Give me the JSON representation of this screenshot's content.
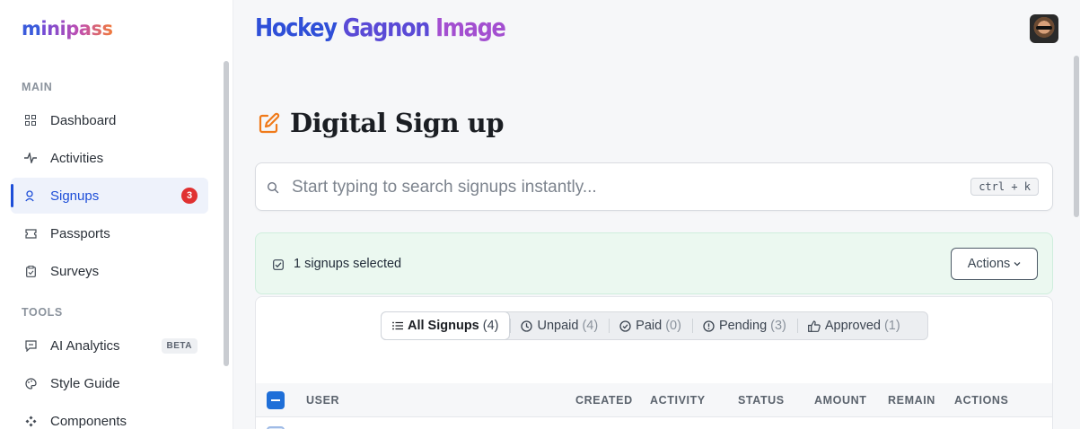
{
  "app": {
    "logo_prefix": "m",
    "logo_rest": "inipass"
  },
  "sidebar": {
    "sections": [
      {
        "label": "MAIN",
        "items": [
          {
            "label": "Dashboard",
            "icon": "dashboard-grid-icon"
          },
          {
            "label": "Activities",
            "icon": "activity-pulse-icon"
          },
          {
            "label": "Signups",
            "icon": "user-signup-icon",
            "active": true,
            "badge": "3"
          },
          {
            "label": "Passports",
            "icon": "ticket-icon"
          },
          {
            "label": "Surveys",
            "icon": "clipboard-icon"
          }
        ]
      },
      {
        "label": "TOOLS",
        "items": [
          {
            "label": "AI Analytics",
            "icon": "chat-analytics-icon",
            "tag": "BETA"
          },
          {
            "label": "Style Guide",
            "icon": "palette-icon"
          },
          {
            "label": "Components",
            "icon": "components-icon"
          }
        ]
      }
    ]
  },
  "header": {
    "org_title_words": [
      "Hockey",
      "Gagnon",
      "Image"
    ]
  },
  "page": {
    "title": "Digital Sign up",
    "icon": "edit-pencil-icon"
  },
  "search": {
    "placeholder": "Start typing to search signups instantly...",
    "value": "",
    "shortcut": "ctrl + k"
  },
  "selection": {
    "text": "1 signups selected",
    "actions_label": "Actions"
  },
  "filters": [
    {
      "label": "All Signups",
      "count": "(4)",
      "icon": "list-icon",
      "active": true
    },
    {
      "label": "Unpaid",
      "count": "(4)",
      "icon": "clock-icon"
    },
    {
      "label": "Paid",
      "count": "(0)",
      "icon": "check-circle-icon"
    },
    {
      "label": "Pending",
      "count": "(3)",
      "icon": "alert-circle-icon"
    },
    {
      "label": "Approved",
      "count": "(1)",
      "icon": "thumbs-up-icon"
    }
  ],
  "table": {
    "columns": [
      "USER",
      "CREATED",
      "ACTIVITY",
      "STATUS",
      "AMOUNT",
      "REMAIN",
      "ACTIONS"
    ]
  },
  "colors": {
    "accent": "#1d4ed8",
    "badge": "#e03131",
    "selection_bg": "#ebf8f0",
    "title_icon": "#f07a1a"
  }
}
